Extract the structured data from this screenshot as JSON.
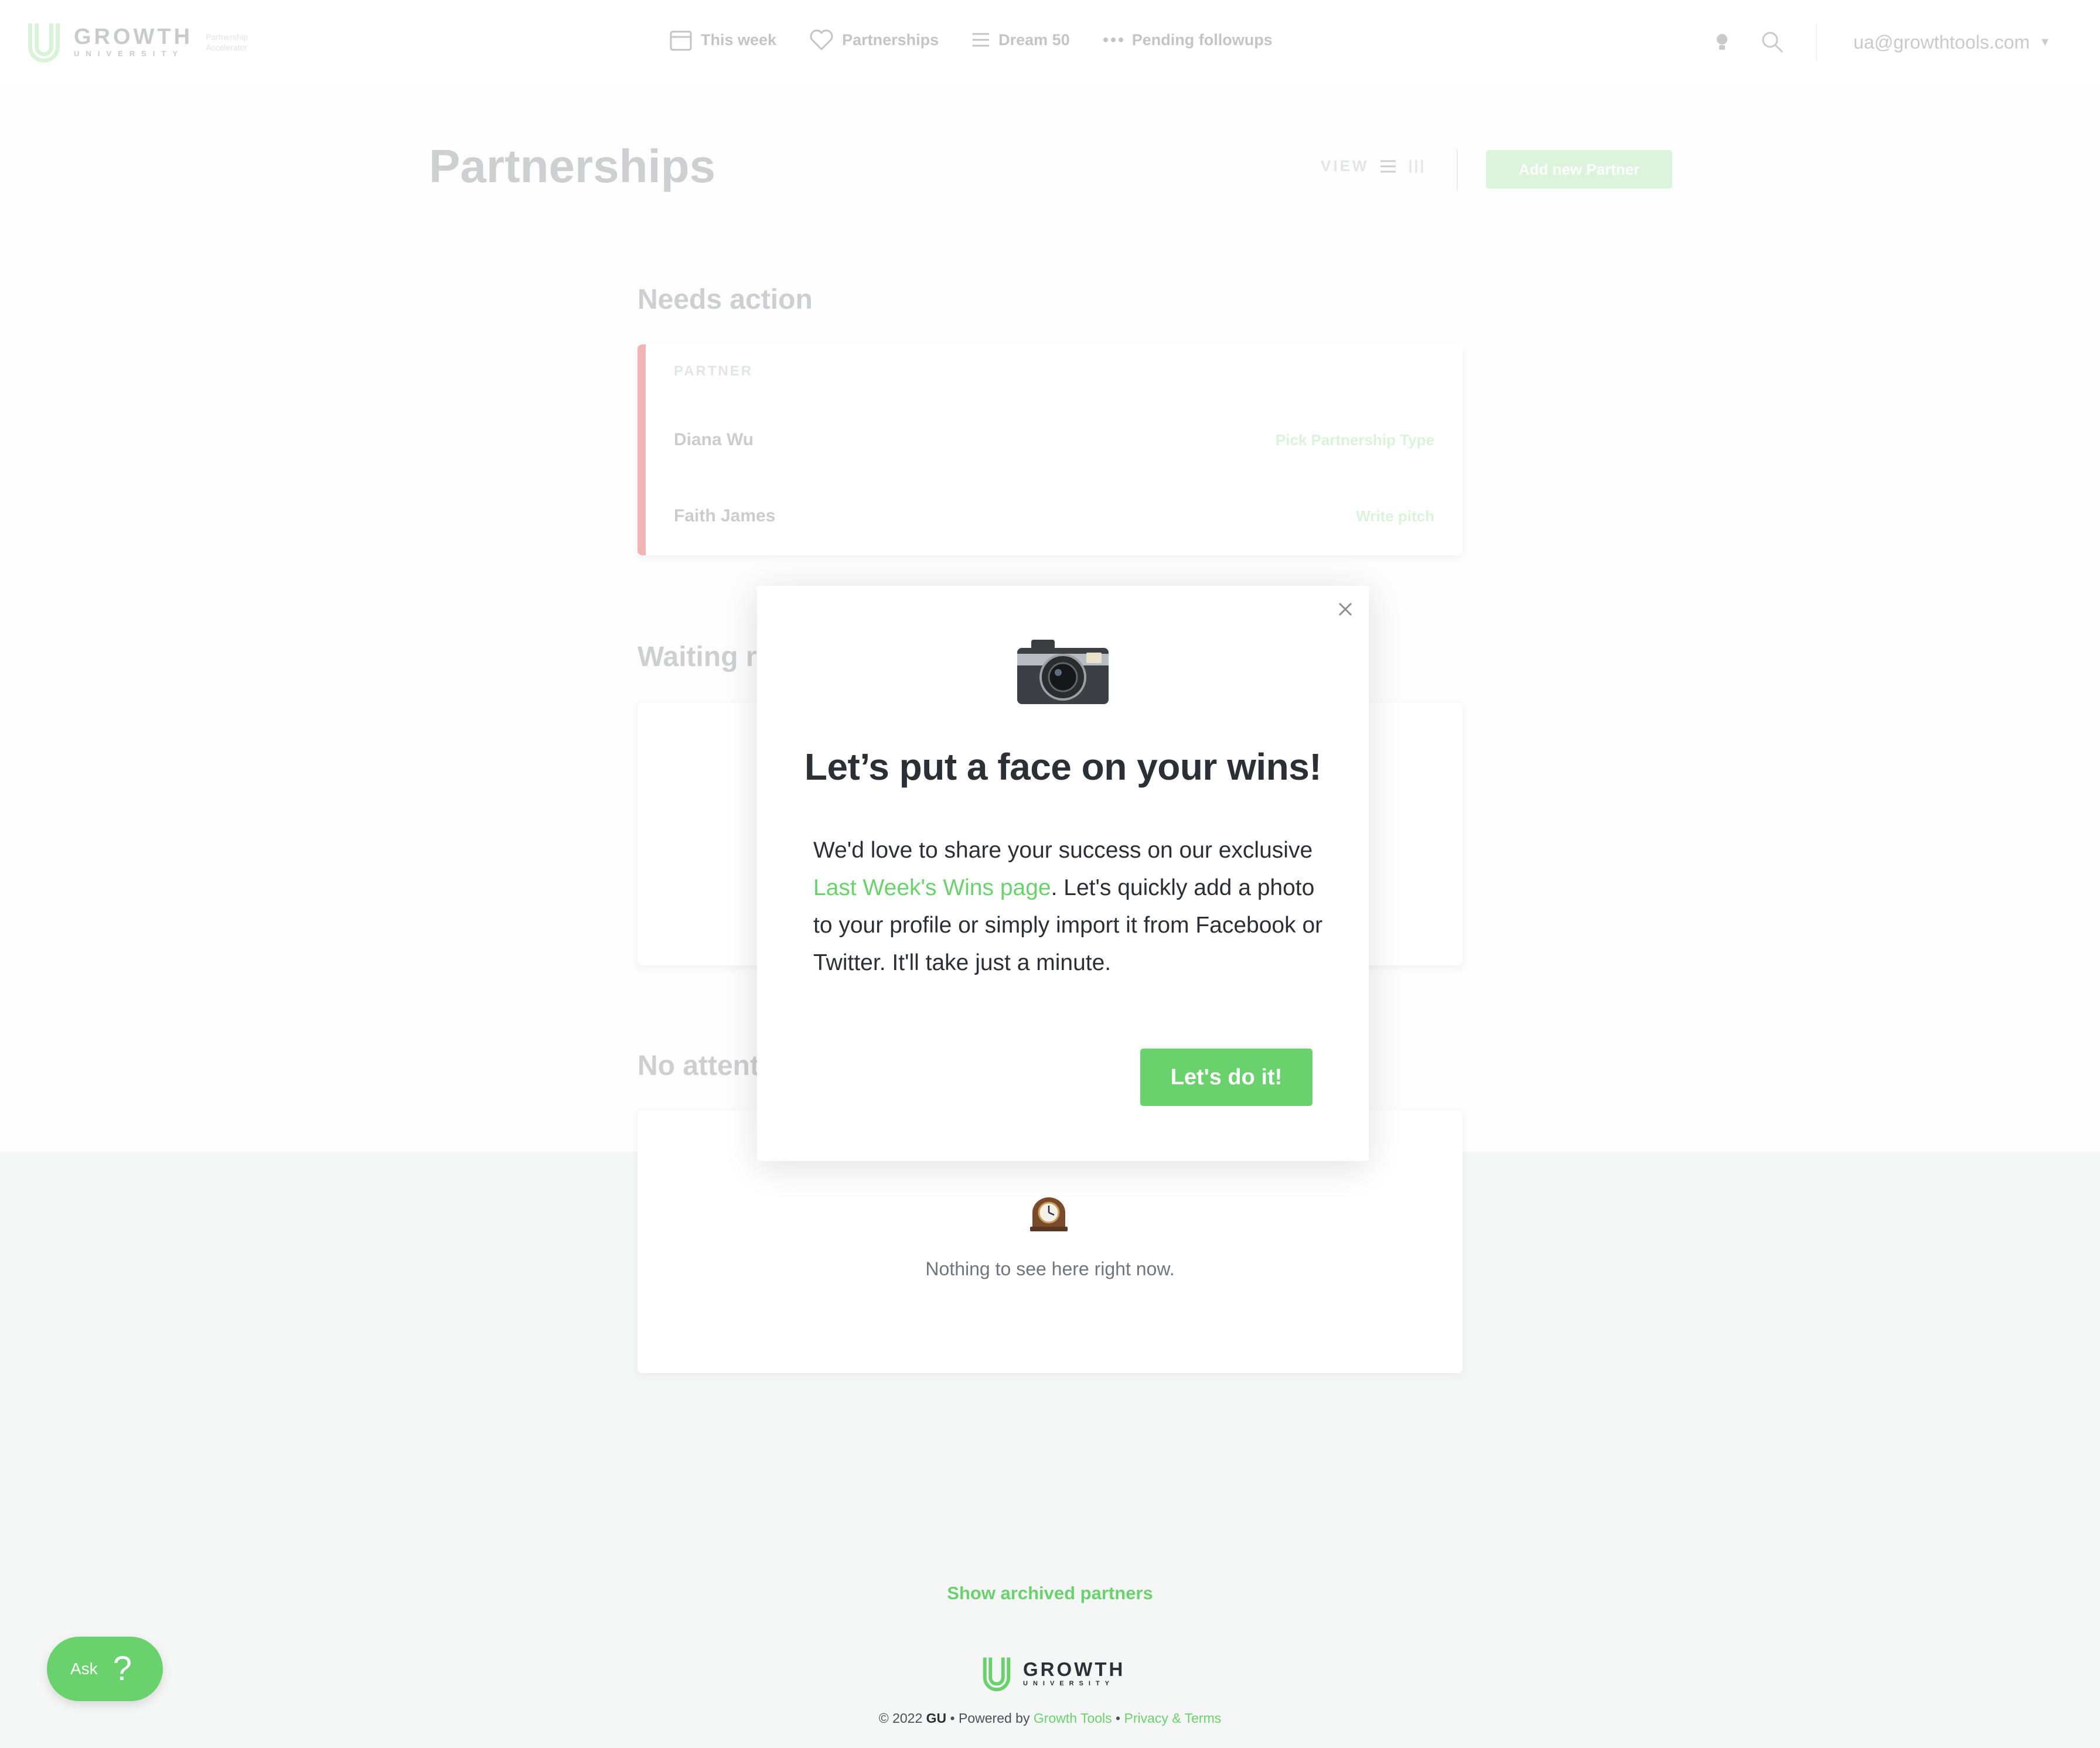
{
  "nav": {
    "logo_big": "GROWTH",
    "logo_small": "UNIVERSITY",
    "logo_tag_line1": "Partnership",
    "logo_tag_line2": "Accelerator",
    "links": [
      {
        "label": "This week",
        "icon": "calendar-icon"
      },
      {
        "label": "Partnerships",
        "icon": "heart-icon"
      },
      {
        "label": "Dream 50",
        "icon": "list-icon"
      },
      {
        "label": "Pending followups",
        "icon": "dots-icon"
      }
    ],
    "user_email": "ua@growthtools.com"
  },
  "page": {
    "title": "Partnerships",
    "view_label": "VIEW",
    "add_button": "Add new Partner"
  },
  "sections": {
    "needs_action": {
      "heading": "Needs action",
      "column_header": "PARTNER",
      "rows": [
        {
          "name": "Diana Wu",
          "action": "Pick Partnership Type"
        },
        {
          "name": "Faith James",
          "action": "Write pitch"
        }
      ]
    },
    "waiting": {
      "heading": "Waiting r"
    },
    "no_attention": {
      "heading": "No attent",
      "empty_text": "Nothing to see here right now."
    }
  },
  "modal": {
    "title": "Let’s put a face on your wins!",
    "body_before": "We'd love to share your success on our exclusive ",
    "body_link": "Last Week's Wins page",
    "body_after": ". Let's quickly add a photo to your profile or simply import it from Facebook or Twitter. It'll take just a minute.",
    "cta": "Let's do it!"
  },
  "footer": {
    "archived_link": "Show archived partners",
    "logo_big": "GROWTH",
    "logo_small": "UNIVERSITY",
    "copyright_prefix": "© 2022 ",
    "copyright_brand": "GU",
    "powered_by": " • Powered by ",
    "growth_tools": "Growth Tools",
    "sep": " • ",
    "privacy": "Privacy & Terms"
  },
  "ask": {
    "label": "Ask",
    "icon": "?"
  },
  "colors": {
    "accent": "#6ad26c",
    "danger_stripe": "#f3b4b8",
    "text": "#2b3036"
  }
}
